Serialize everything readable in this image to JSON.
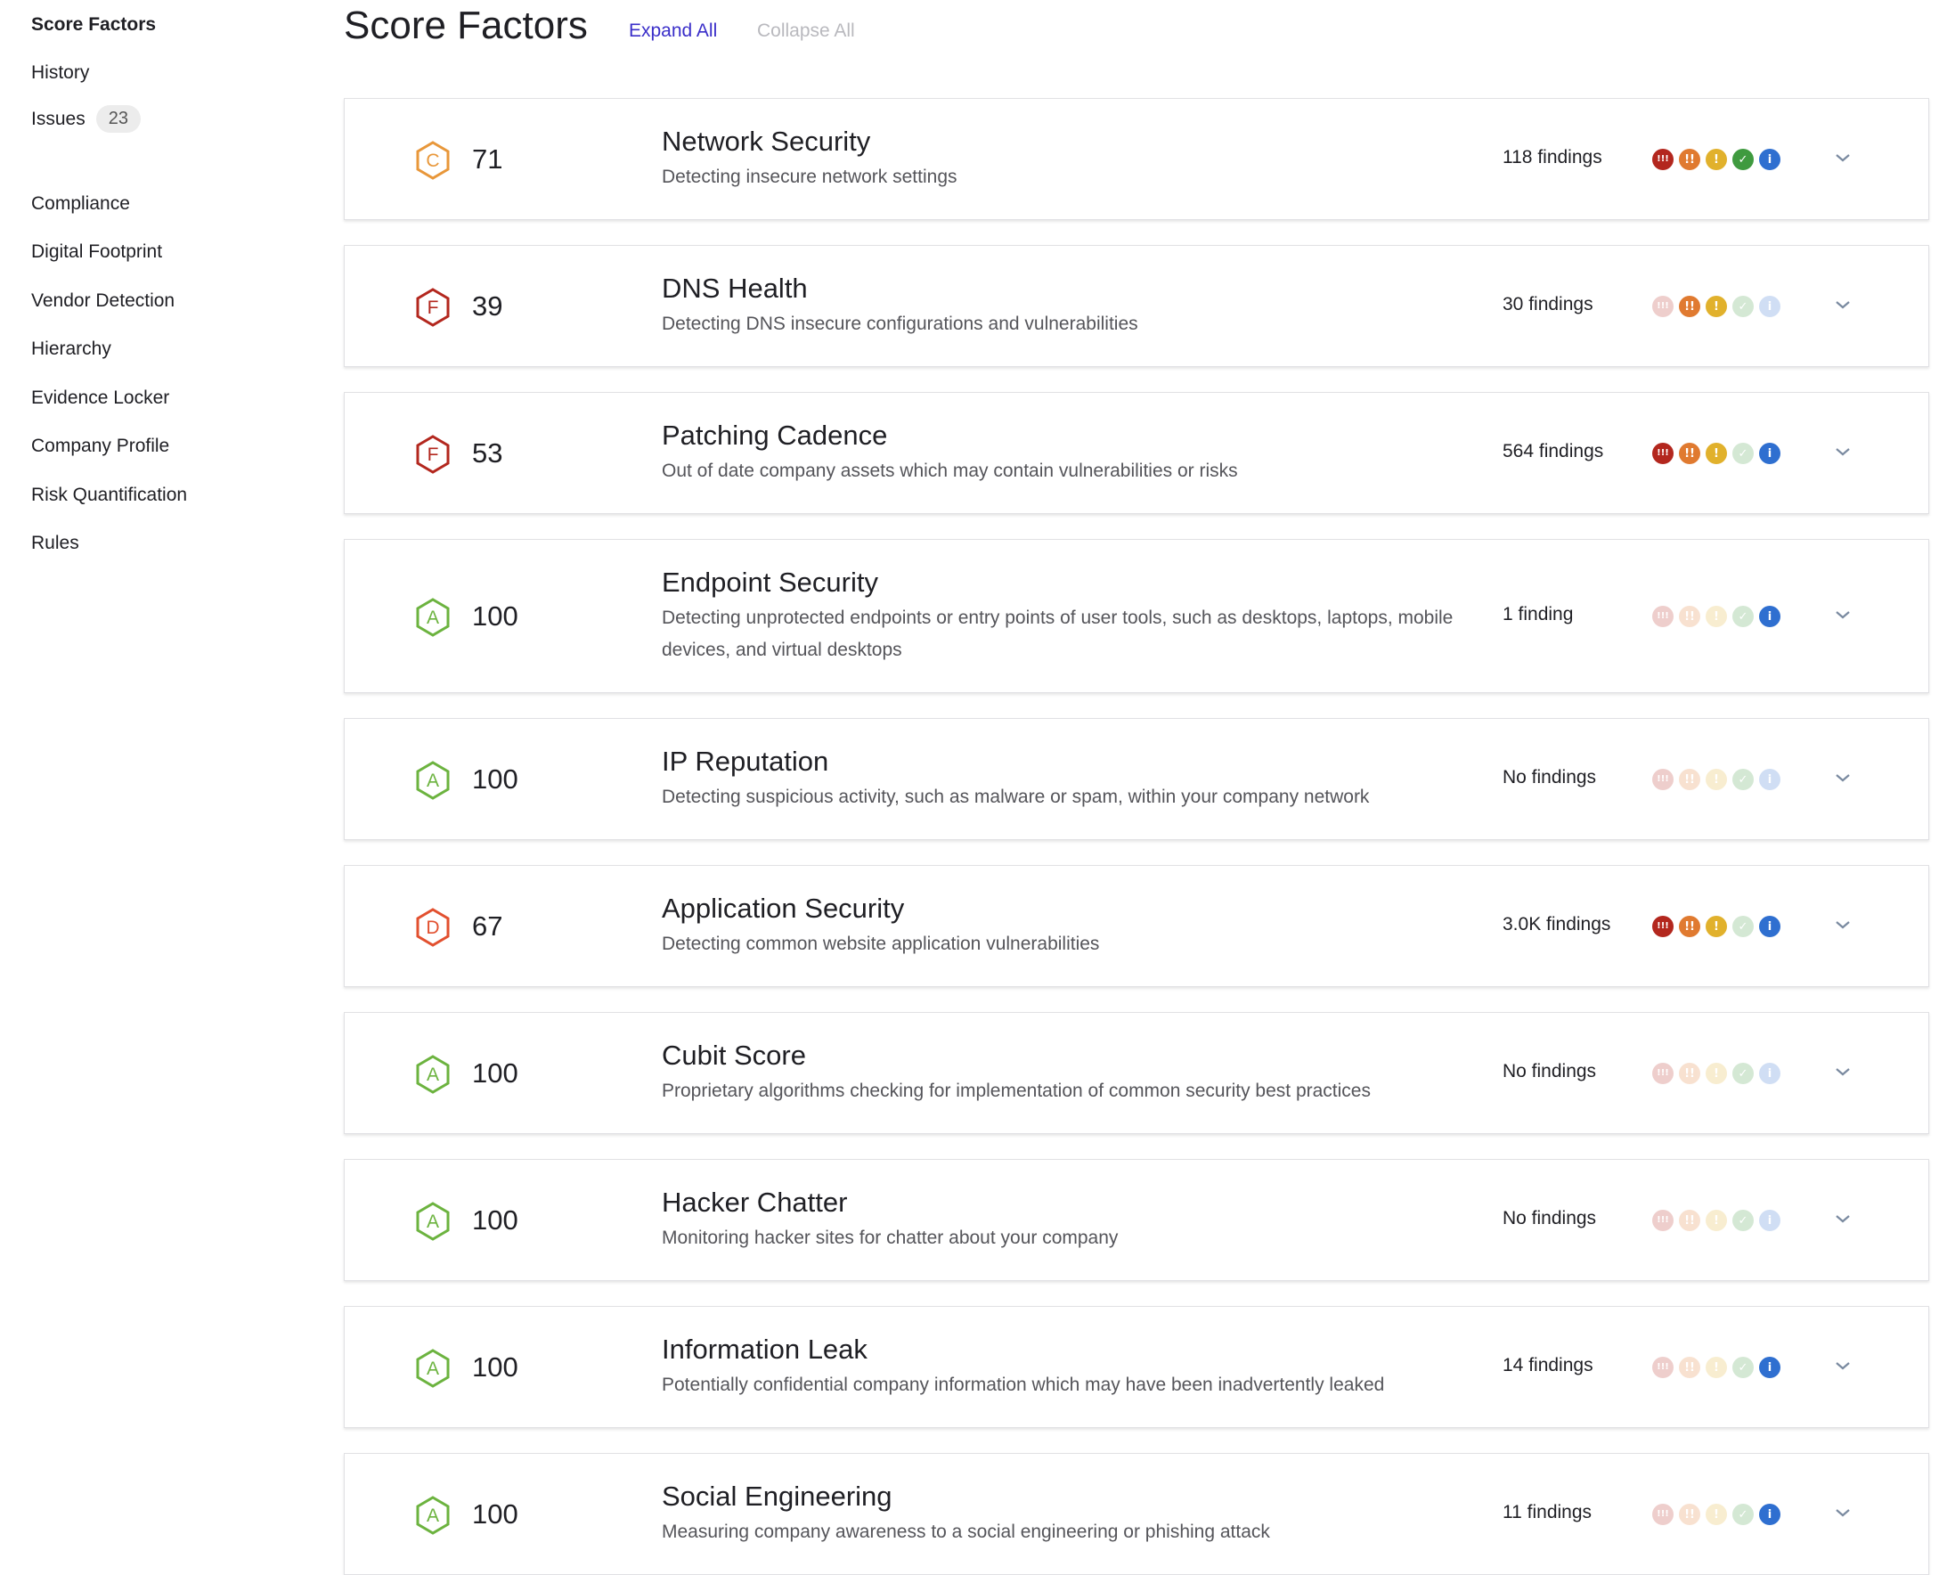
{
  "sidebar": {
    "items": [
      {
        "label": "Score Factors",
        "active": true
      },
      {
        "label": "History"
      },
      {
        "label": "Issues",
        "badge": "23"
      },
      {
        "label": "Compliance"
      },
      {
        "label": "Digital Footprint"
      },
      {
        "label": "Vendor Detection"
      },
      {
        "label": "Hierarchy"
      },
      {
        "label": "Evidence Locker"
      },
      {
        "label": "Company Profile"
      },
      {
        "label": "Risk Quantification"
      },
      {
        "label": "Rules"
      }
    ]
  },
  "header": {
    "title": "Score Factors",
    "expand_all": "Expand All",
    "collapse_all": "Collapse All"
  },
  "grade_colors": {
    "A": "#6cb33f",
    "C": "#e8973a",
    "D": "#e2502f",
    "F": "#b3271e"
  },
  "severity_levels": [
    {
      "symbol": "!!!",
      "color": "#b3271e"
    },
    {
      "symbol": "!!",
      "color": "#e07a30"
    },
    {
      "symbol": "!",
      "color": "#e1b12c"
    },
    {
      "symbol": "✓",
      "color": "#3f9a3f"
    },
    {
      "symbol": "i",
      "color": "#2f6fd0"
    }
  ],
  "factors": [
    {
      "grade": "C",
      "score": "71",
      "title": "Network Security",
      "description": "Detecting insecure network settings",
      "findings": "118 findings",
      "severity_active": [
        true,
        true,
        true,
        true,
        true
      ]
    },
    {
      "grade": "F",
      "score": "39",
      "title": "DNS Health",
      "description": "Detecting DNS insecure configurations and vulnerabilities",
      "findings": "30 findings",
      "severity_active": [
        false,
        true,
        true,
        false,
        false
      ]
    },
    {
      "grade": "F",
      "score": "53",
      "title": "Patching Cadence",
      "description": "Out of date company assets which may contain vulnerabilities or risks",
      "findings": "564 findings",
      "severity_active": [
        true,
        true,
        true,
        false,
        true
      ]
    },
    {
      "grade": "A",
      "score": "100",
      "title": "Endpoint Security",
      "description": "Detecting unprotected endpoints or entry points of user tools, such as desktops, laptops, mobile devices, and virtual desktops",
      "findings": "1 finding",
      "severity_active": [
        false,
        false,
        false,
        false,
        true
      ]
    },
    {
      "grade": "A",
      "score": "100",
      "title": "IP Reputation",
      "description": "Detecting suspicious activity, such as malware or spam, within your company network",
      "findings": "No findings",
      "severity_active": [
        false,
        false,
        false,
        false,
        false
      ]
    },
    {
      "grade": "D",
      "score": "67",
      "title": "Application Security",
      "description": "Detecting common website application vulnerabilities",
      "findings": "3.0K findings",
      "severity_active": [
        true,
        true,
        true,
        false,
        true
      ]
    },
    {
      "grade": "A",
      "score": "100",
      "title": "Cubit Score",
      "description": "Proprietary algorithms checking for implementation of common security best practices",
      "findings": "No findings",
      "severity_active": [
        false,
        false,
        false,
        false,
        false
      ]
    },
    {
      "grade": "A",
      "score": "100",
      "title": "Hacker Chatter",
      "description": "Monitoring hacker sites for chatter about your company",
      "findings": "No findings",
      "severity_active": [
        false,
        false,
        false,
        false,
        false
      ]
    },
    {
      "grade": "A",
      "score": "100",
      "title": "Information Leak",
      "description": "Potentially confidential company information which may have been inadvertently leaked",
      "findings": "14 findings",
      "severity_active": [
        false,
        false,
        false,
        false,
        true
      ]
    },
    {
      "grade": "A",
      "score": "100",
      "title": "Social Engineering",
      "description": "Measuring company awareness to a social engineering or phishing attack",
      "findings": "11 findings",
      "severity_active": [
        false,
        false,
        false,
        false,
        true
      ]
    }
  ]
}
